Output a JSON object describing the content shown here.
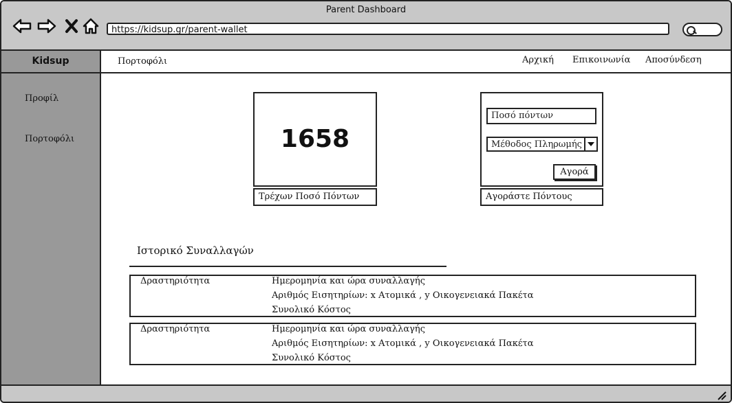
{
  "window": {
    "title": "Parent Dashboard"
  },
  "browser": {
    "url": "https://kidsup.gr/parent-wallet",
    "search_placeholder": ""
  },
  "sidebar": {
    "brand": "Kidsup",
    "items": [
      {
        "label": "Προφίλ"
      },
      {
        "label": "Πορτοφόλι"
      }
    ]
  },
  "topnav": {
    "breadcrumb": "Πορτοφόλι",
    "links": [
      {
        "label": "Αρχική"
      },
      {
        "label": "Επικοινωνία"
      },
      {
        "label": "Αποσύνδεση"
      }
    ]
  },
  "points": {
    "value": "1658",
    "caption": "Τρέχων Ποσό Πόντων"
  },
  "buy": {
    "amount_placeholder": "Ποσό πόντων",
    "payment_method": "Μέθοδος Πληρωμής",
    "button_label": "Αγορά",
    "caption": "Αγοράστε Πόντους"
  },
  "history": {
    "title": "Ιστορικό Συναλλαγών",
    "rows": [
      {
        "activity": "Δραστηριότητα",
        "datetime": "Ημερομηνία και ώρα συναλλαγής",
        "tickets": "Αριθμός Εισητηρίων: x Ατομικά , y Οικογενειακά Πακέτα",
        "total": "Συνολικό Κόστος"
      },
      {
        "activity": "Δραστηριότητα",
        "datetime": "Ημερομηνία και ώρα συναλλαγής",
        "tickets": "Αριθμός Εισητηρίων: x Ατομικά , y Οικογενειακά Πακέτα",
        "total": "Συνολικό Κόστος"
      }
    ]
  },
  "icons": {
    "back": "arrow-left-icon",
    "forward": "arrow-right-icon",
    "stop": "close-icon",
    "home": "home-icon",
    "search": "search-icon",
    "resize": "resize-grip-icon"
  },
  "colors": {
    "chrome": "#c8c8c8",
    "sidebar": "#999999",
    "stroke": "#222222"
  }
}
